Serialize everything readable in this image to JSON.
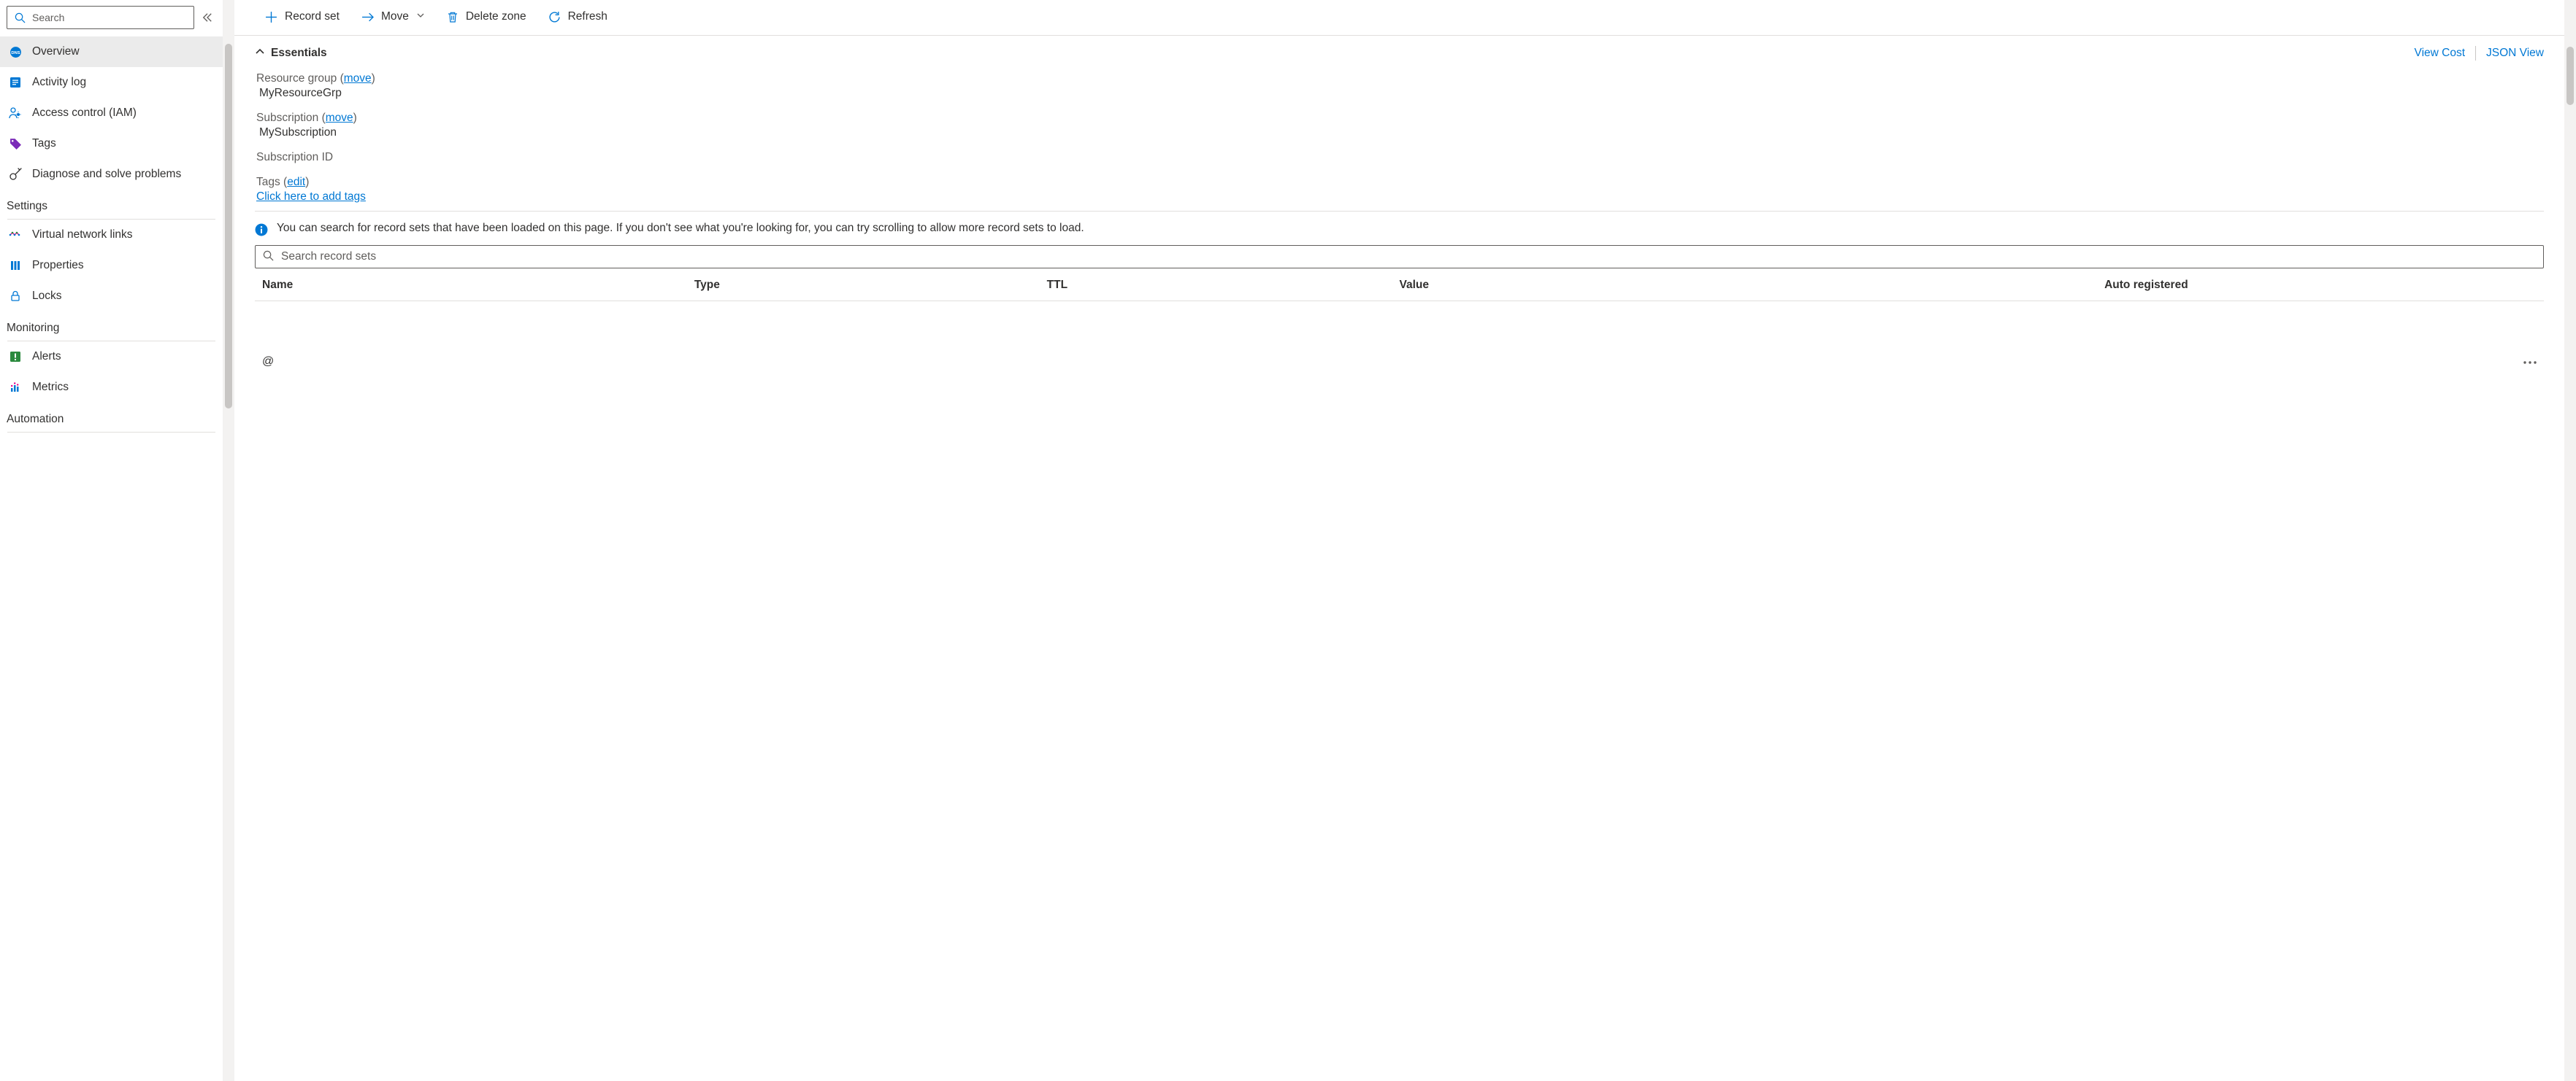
{
  "sidebar": {
    "search_placeholder": "Search",
    "items": [
      {
        "label": "Overview",
        "selected": true,
        "icon": "dns-zone-icon",
        "color": "#0078d4"
      },
      {
        "label": "Activity log",
        "selected": false,
        "icon": "activity-log-icon",
        "color": "#0078d4"
      },
      {
        "label": "Access control (IAM)",
        "selected": false,
        "icon": "access-control-icon",
        "color": "#0078d4"
      },
      {
        "label": "Tags",
        "selected": false,
        "icon": "tags-icon",
        "color": "#7b2bb8"
      },
      {
        "label": "Diagnose and solve problems",
        "selected": false,
        "icon": "diagnose-icon",
        "color": "#323130"
      }
    ],
    "sections": [
      {
        "header": "Settings",
        "items": [
          {
            "label": "Virtual network links",
            "icon": "vnet-links-icon",
            "color": "#0078d4"
          },
          {
            "label": "Properties",
            "icon": "properties-icon",
            "color": "#0078d4"
          },
          {
            "label": "Locks",
            "icon": "locks-icon",
            "color": "#0078d4"
          }
        ]
      },
      {
        "header": "Monitoring",
        "items": [
          {
            "label": "Alerts",
            "icon": "alerts-icon",
            "color": "#2b8a3e"
          },
          {
            "label": "Metrics",
            "icon": "metrics-icon",
            "color": "#0078d4"
          }
        ]
      },
      {
        "header": "Automation",
        "items": []
      }
    ]
  },
  "toolbar": {
    "record_set": "Record set",
    "move": "Move",
    "delete_zone": "Delete zone",
    "refresh": "Refresh"
  },
  "essentials": {
    "header": "Essentials",
    "view_cost": "View Cost",
    "json_view": "JSON View",
    "resource_group_label": "Resource group",
    "move1": "move",
    "resource_group_value": "MyResourceGrp",
    "subscription_label": "Subscription",
    "move2": "move",
    "subscription_value": "MySubscription",
    "subscription_id_label": "Subscription ID",
    "subscription_id_value": "",
    "tags_label": "Tags",
    "edit": "edit",
    "add_tags": "Click here to add tags"
  },
  "info_text": "You can search for record sets that have been loaded on this page. If you don't see what you're looking for, you can try scrolling to allow more record sets to load.",
  "records": {
    "search_placeholder": "Search record sets",
    "headers": {
      "name": "Name",
      "type": "Type",
      "ttl": "TTL",
      "value": "Value",
      "auto": "Auto registered"
    },
    "rows": [
      {
        "name": "@",
        "type": "",
        "ttl": "",
        "value": "",
        "auto": ""
      }
    ]
  }
}
